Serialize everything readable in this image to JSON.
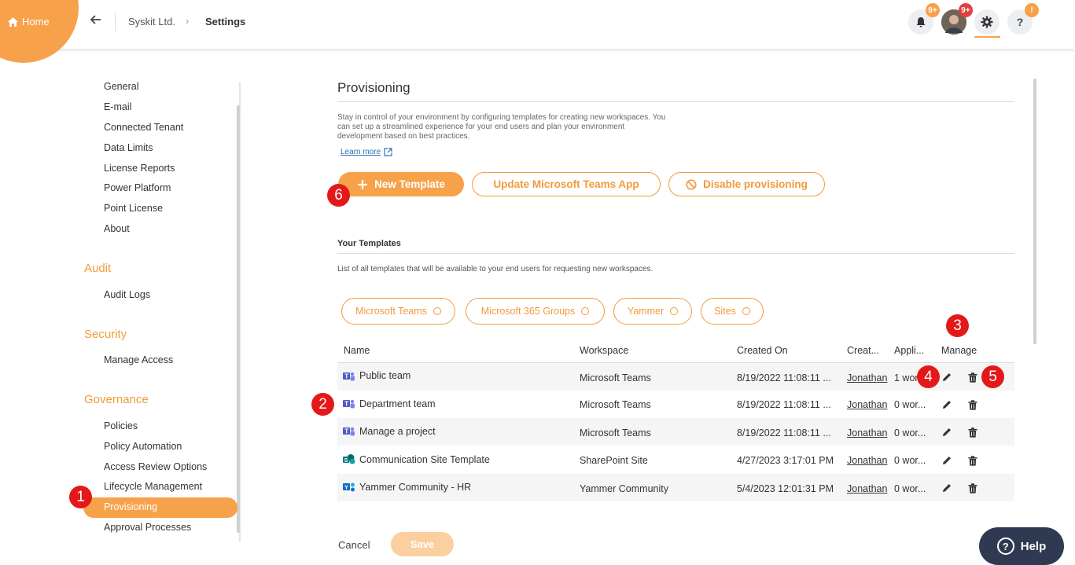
{
  "topbar": {
    "home_label": "Home",
    "org": "Syskit Ltd.",
    "current": "Settings",
    "notifications_badge": "9+",
    "avatar_badge": "9+",
    "help_badge": "!",
    "help_icon_label": "?",
    "accent": "#f7a24b"
  },
  "sidebar": {
    "general_items": [
      "General",
      "E-mail",
      "Connected Tenant",
      "Data Limits",
      "License Reports",
      "Power Platform",
      "Point License",
      "About"
    ],
    "audit_heading": "Audit",
    "audit_items": [
      "Audit Logs"
    ],
    "security_heading": "Security",
    "security_items": [
      "Manage Access"
    ],
    "governance_heading": "Governance",
    "governance_items": [
      "Policies",
      "Policy Automation",
      "Access Review Options",
      "Lifecycle Management",
      "Provisioning",
      "Approval Processes"
    ]
  },
  "markers": [
    "1",
    "2",
    "3",
    "4",
    "5",
    "6"
  ],
  "main": {
    "title": "Provisioning",
    "description": "Stay in control of your environment by configuring templates for creating new workspaces. You can set up a streamlined experience for your end users and plan your environment development based on best practices.",
    "learn_more": "Learn more",
    "buttons": {
      "new_template": "New Template",
      "update_teams_app": "Update Microsoft Teams App",
      "disable_provisioning": "Disable provisioning"
    },
    "templates_title": "Your Templates",
    "templates_desc": "List of all templates that will be available to your end users for requesting new workspaces.",
    "filters": [
      "Microsoft Teams",
      "Microsoft 365 Groups",
      "Yammer",
      "Sites"
    ],
    "columns": [
      "Name",
      "Workspace",
      "Created On",
      "Creat...",
      "Appli...",
      "Manage"
    ],
    "rows": [
      {
        "name": "Public team",
        "workspace": "Microsoft Teams",
        "created_on": "8/19/2022 11:08:11 ...",
        "created_by": "Jonathan",
        "applied": "1 wor...",
        "icon": "teams-icon"
      },
      {
        "name": "Department team",
        "workspace": "Microsoft Teams",
        "created_on": "8/19/2022 11:08:11 ...",
        "created_by": "Jonathan",
        "applied": "0 wor...",
        "icon": "teams-icon"
      },
      {
        "name": "Manage a project",
        "workspace": "Microsoft Teams",
        "created_on": "8/19/2022 11:08:11 ...",
        "created_by": "Jonathan",
        "applied": "0 wor...",
        "icon": "teams-icon"
      },
      {
        "name": "Communication Site Template",
        "workspace": "SharePoint Site",
        "created_on": "4/27/2023 3:17:01 PM",
        "created_by": "Jonathan",
        "applied": "0 wor...",
        "icon": "sharepoint-icon"
      },
      {
        "name": "Yammer Community - HR",
        "workspace": "Yammer Community",
        "created_on": "5/4/2023 12:01:31 PM",
        "created_by": "Jonathan",
        "applied": "0 wor...",
        "icon": "yammer-icon"
      }
    ],
    "cancel": "Cancel",
    "save": "Save",
    "help": "Help"
  }
}
